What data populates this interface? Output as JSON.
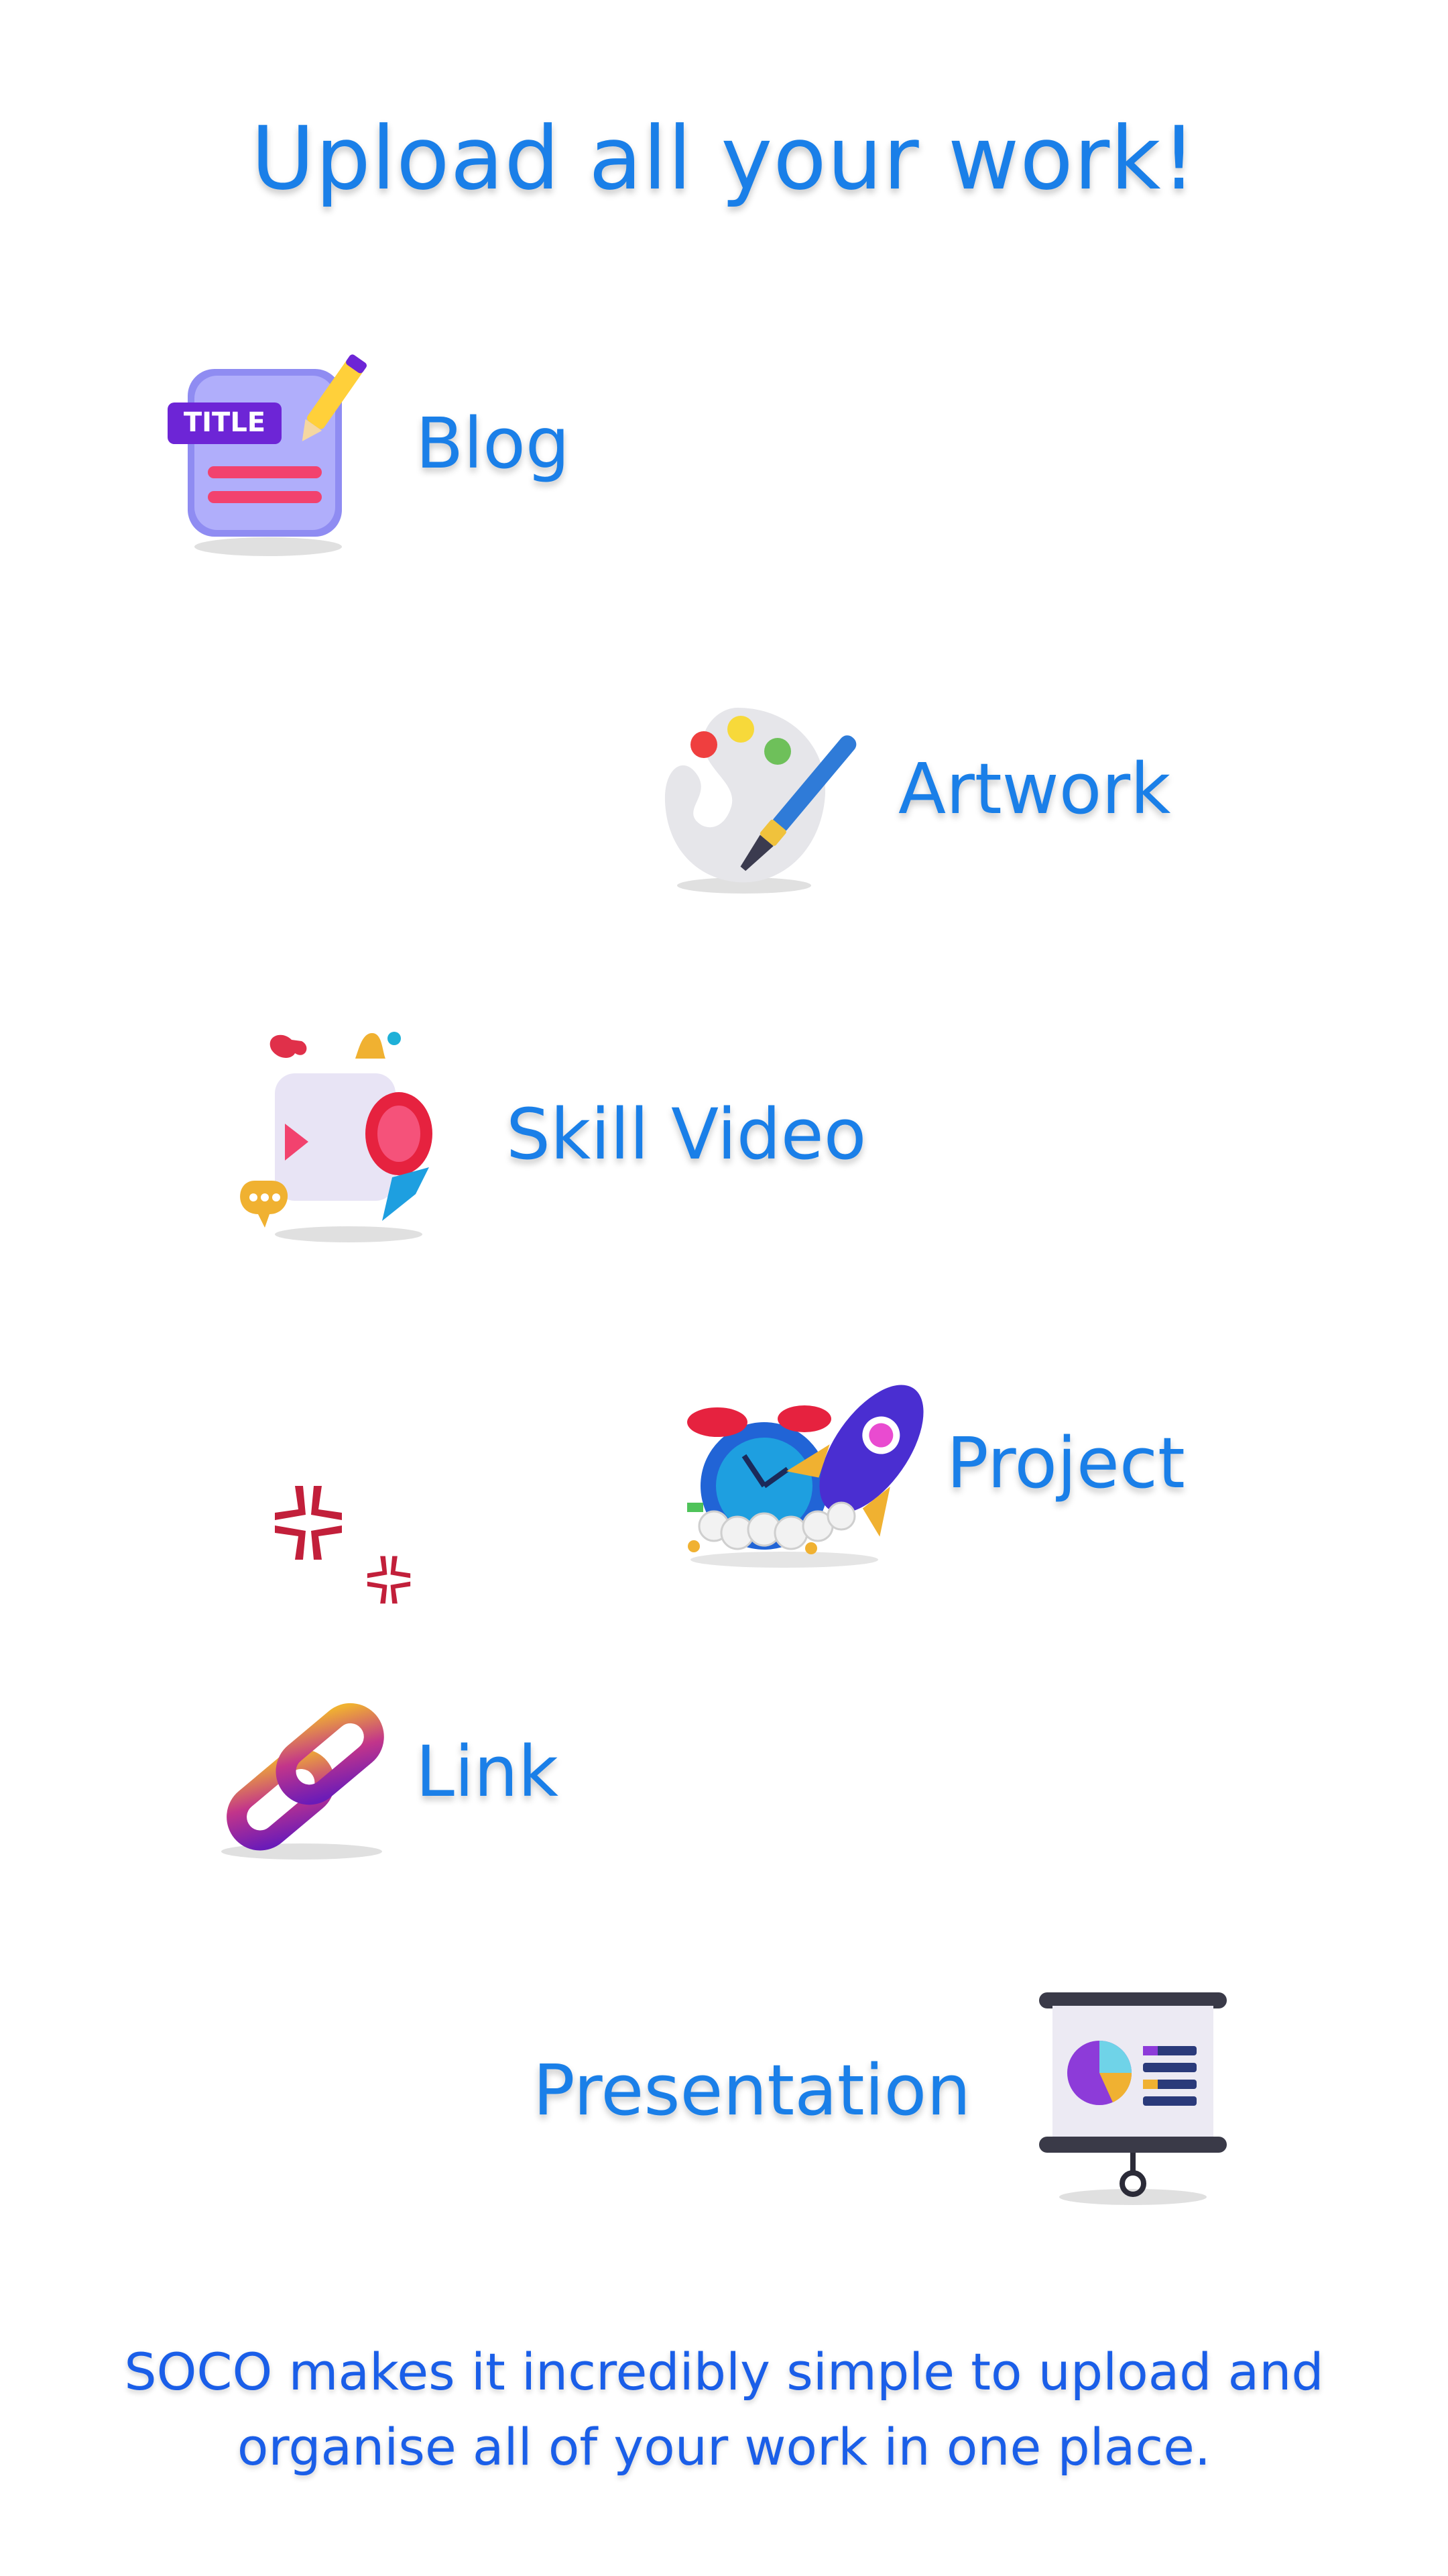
{
  "page": {
    "title": "Upload all your work!",
    "footer_text": "SOCO makes it incredibly simple to upload and organise all of your work in one place."
  },
  "items": [
    {
      "label": "Blog",
      "icon": "blog-title-document-icon"
    },
    {
      "label": "Artwork",
      "icon": "paint-palette-icon"
    },
    {
      "label": "Skill Video",
      "icon": "video-camera-icon"
    },
    {
      "label": "Project",
      "icon": "rocket-clock-icon"
    },
    {
      "label": "Link",
      "icon": "chain-link-icon"
    },
    {
      "label": "Presentation",
      "icon": "presentation-board-icon"
    }
  ],
  "blog_icon_text": "TITLE",
  "colors": {
    "accent": "#1a7fe8",
    "footer": "#1a5ee8",
    "background": "#ffffff"
  }
}
